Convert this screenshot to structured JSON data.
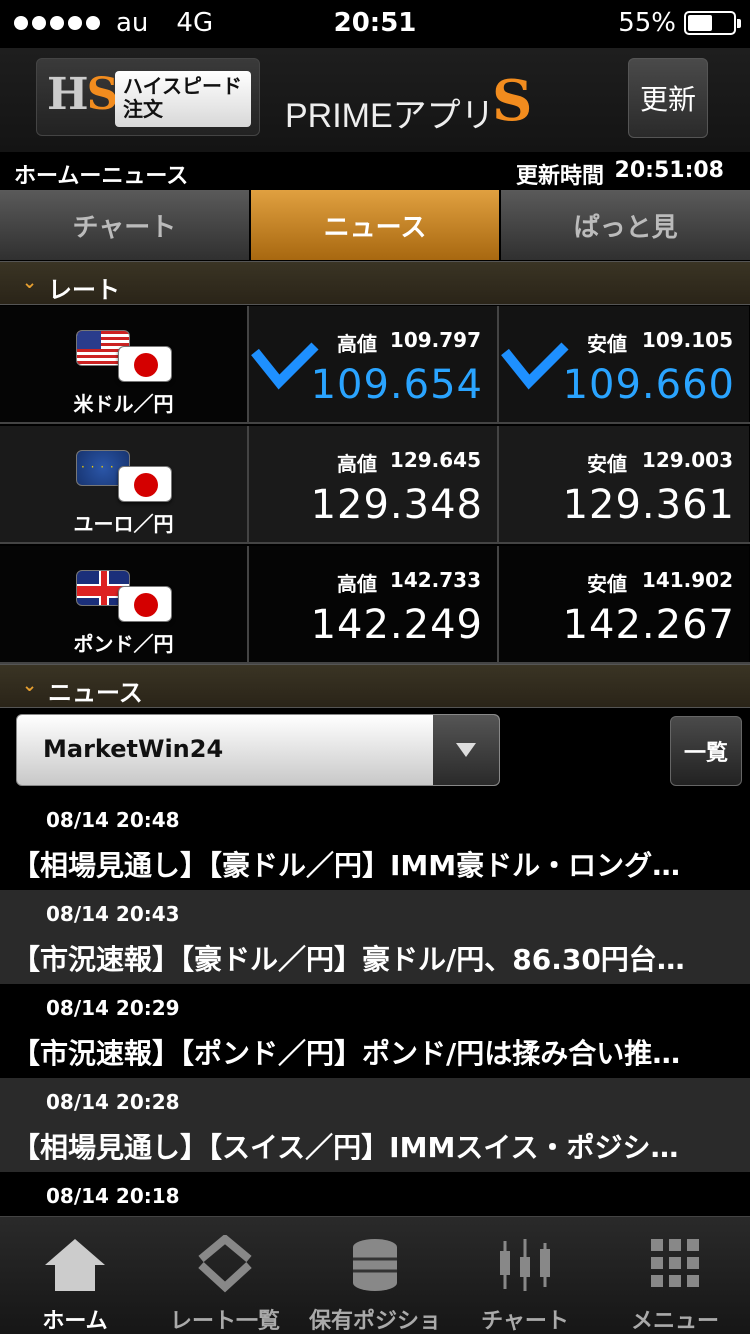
{
  "status": {
    "carrier": "au",
    "network": "4G",
    "time": "20:51",
    "battery": "55%",
    "battery_level": 0.55
  },
  "header": {
    "logo_mark": "HS",
    "logo_label_line1": "ハイスピード",
    "logo_label_line2": "注文",
    "app_name": "PRIMEアプリ",
    "app_name_suffix": "S",
    "refresh_label": "更新"
  },
  "breadcrumb": {
    "title": "ホームーニュース",
    "updated_label": "更新時間",
    "updated_time": "20:51:08"
  },
  "tabs": [
    {
      "label": "チャート",
      "active": false
    },
    {
      "label": "ニュース",
      "active": true
    },
    {
      "label": "ぱっと見",
      "active": false
    }
  ],
  "rates_section": {
    "label": "レート"
  },
  "rates": [
    {
      "pair": "米ドル／円",
      "high_label": "高値",
      "high": "109.797",
      "bid": "109.654",
      "low_label": "安値",
      "low": "109.105",
      "ask": "109.660",
      "trend": "down"
    },
    {
      "pair": "ユーロ／円",
      "high_label": "高値",
      "high": "129.645",
      "bid": "129.348",
      "low_label": "安値",
      "low": "129.003",
      "ask": "129.361",
      "trend": "none"
    },
    {
      "pair": "ポンド／円",
      "high_label": "高値",
      "high": "142.733",
      "bid": "142.249",
      "low_label": "安値",
      "low": "141.902",
      "ask": "142.267",
      "trend": "none"
    }
  ],
  "news_section": {
    "label": "ニュース"
  },
  "news_source": {
    "selected": "MarketWin24",
    "list_button": "一覧"
  },
  "news": [
    {
      "datetime": "08/14 20:48",
      "headline": "【相場見通し】【豪ドル／円】IMM豪ドル・ロング…"
    },
    {
      "datetime": "08/14 20:43",
      "headline": "【市況速報】【豪ドル／円】豪ドル/円、86.30円台…"
    },
    {
      "datetime": "08/14 20:29",
      "headline": "【市況速報】【ポンド／円】ポンド/円は揉み合い推…"
    },
    {
      "datetime": "08/14 20:28",
      "headline": "【相場見通し】【スイス／円】IMMスイス・ポジシ…"
    },
    {
      "datetime": "08/14 20:18",
      "headline": ""
    }
  ],
  "bottom_nav": [
    {
      "label": "ホーム",
      "icon": "home-icon",
      "active": true
    },
    {
      "label": "レート一覧",
      "icon": "rates-icon",
      "active": false
    },
    {
      "label": "保有ポジション",
      "icon": "coins-icon",
      "active": false
    },
    {
      "label": "チャート",
      "icon": "chart-icon",
      "active": false
    },
    {
      "label": "メニュー",
      "icon": "grid-menu-icon",
      "active": false
    }
  ],
  "colors": {
    "accent": "#e0a040",
    "price_blue": "#2aa4ff",
    "brand_orange": "#f28c1e"
  }
}
